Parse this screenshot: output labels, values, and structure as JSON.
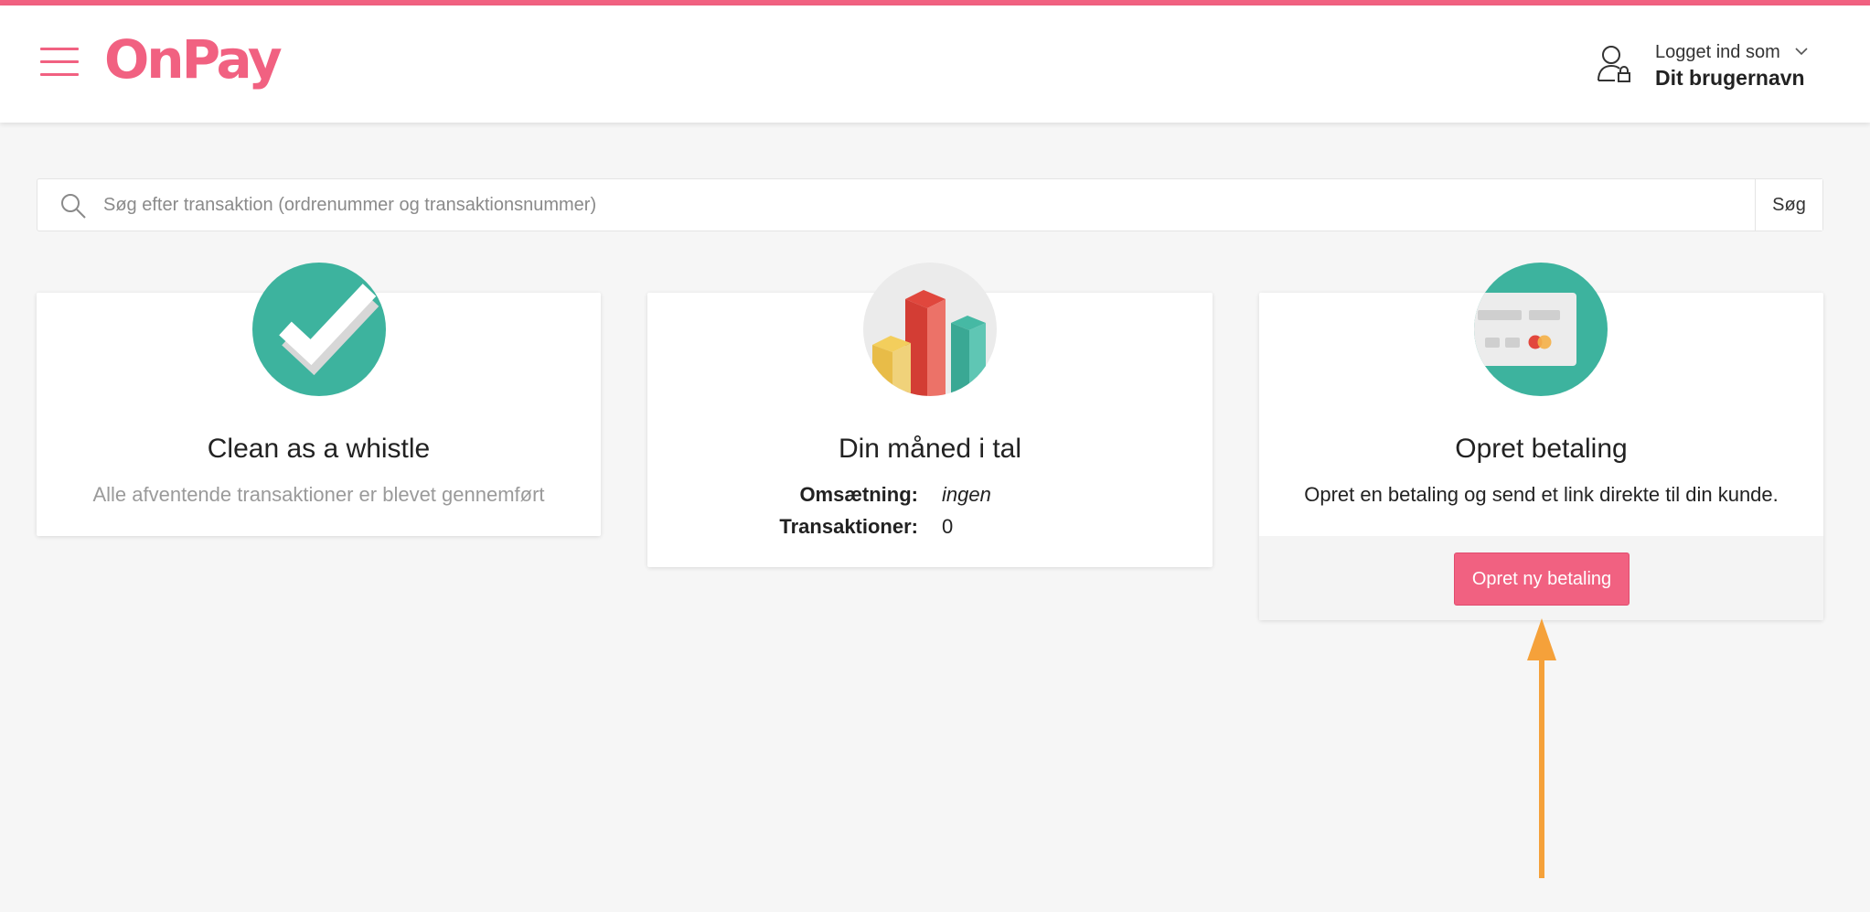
{
  "header": {
    "logo_text": "OnPay",
    "user_caption": "Logget ind som",
    "user_name": "Dit brugernavn",
    "menu_icon": "hamburger-menu-icon",
    "user_icon": "user-lock-icon"
  },
  "search": {
    "placeholder": "Søg efter transaktion (ordrenummer og transaktionsnummer)",
    "value": "",
    "button_label": "Søg"
  },
  "cards": [
    {
      "icon": "checkmark-icon",
      "title": "Clean as a whistle",
      "text": "Alle afventende transaktioner er blevet gennemført"
    },
    {
      "icon": "bar-chart-icon",
      "title": "Din måned i tal",
      "stats": [
        {
          "label": "Omsætning:",
          "value": "ingen"
        },
        {
          "label": "Transaktioner:",
          "value": "0"
        }
      ]
    },
    {
      "icon": "credit-card-icon",
      "title": "Opret betaling",
      "text": "Opret en betaling og send et link direkte til din kunde.",
      "button_label": "Opret ny betaling"
    }
  ],
  "annotation": {
    "arrow_icon": "arrow-up-icon",
    "arrow_color": "#f5a13a"
  },
  "colors": {
    "brand": "#f16181",
    "accent_green": "#3db39e",
    "background": "#f6f6f6"
  }
}
